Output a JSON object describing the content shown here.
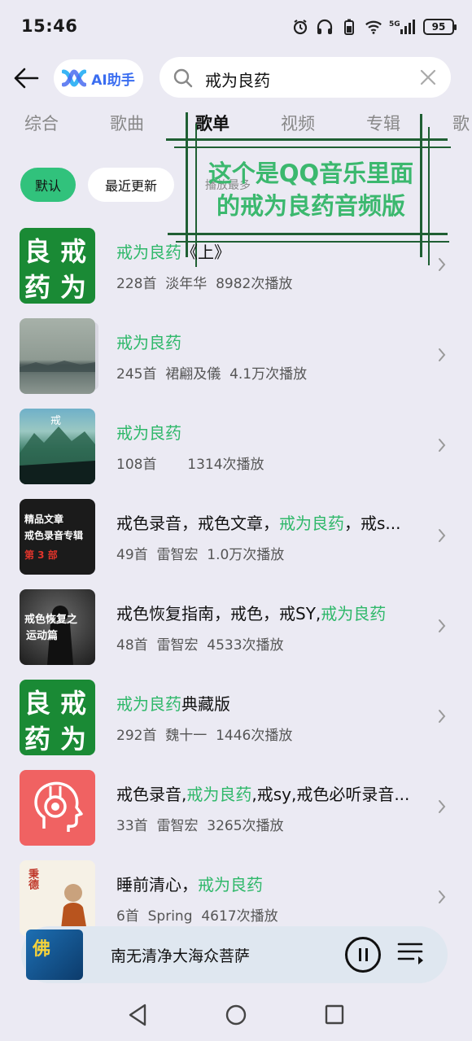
{
  "status": {
    "time": "15:46",
    "battery": "95",
    "network": "5G"
  },
  "header": {
    "ai_label": "AI助手",
    "search_value": "戒为良药"
  },
  "tabs": [
    "综合",
    "歌曲",
    "歌单",
    "视频",
    "专辑",
    "歌"
  ],
  "active_tab": "歌单",
  "filters": {
    "default": "默认",
    "recent": "最近更新",
    "most_played": "播放最多"
  },
  "overlay": {
    "line1": "这个是QQ音乐里面",
    "line2": "的戒为良药音频版"
  },
  "playlists": [
    {
      "title_hl": "戒为良药",
      "title_rest": "《上》",
      "count": "228首",
      "author": "淡年华",
      "plays": "8982次播放"
    },
    {
      "title_hl": "戒为良药",
      "title_rest": "",
      "count": "245首",
      "author": "裙翩及儀",
      "plays": "4.1万次播放"
    },
    {
      "title_hl": "戒为良药",
      "title_rest": "",
      "count": "108首",
      "author": "",
      "plays": "1314次播放"
    },
    {
      "title_pre": "戒色录音，戒色文章，",
      "title_hl": "戒为良药",
      "title_rest": "，戒s...",
      "count": "49首",
      "author": "雷智宏",
      "plays": "1.0万次播放"
    },
    {
      "title_pre": "戒色恢复指南，戒色，戒SY,",
      "title_hl": "戒为良药",
      "title_rest": "",
      "count": "48首",
      "author": "雷智宏",
      "plays": "4533次播放"
    },
    {
      "title_hl": "戒为良药",
      "title_rest": "典藏版",
      "count": "292首",
      "author": "魏十一",
      "plays": "1446次播放"
    },
    {
      "title_pre": "戒色录音,",
      "title_hl": "戒为良药",
      "title_rest": ",戒sy,戒色必听录音...",
      "count": "33首",
      "author": "雷智宏",
      "plays": "3265次播放"
    },
    {
      "title_pre": "睡前清心，",
      "title_hl": "戒为良药",
      "title_rest": "",
      "count": "6首",
      "author": "Spring",
      "plays": "4617次播放"
    }
  ],
  "covers": {
    "green_chars": [
      "良",
      "戒",
      "药",
      "为"
    ],
    "c3_text": "戒",
    "c4_line1": "精品文章",
    "c4_line2": "戒色录音专辑",
    "c4_line3": "第 3 部",
    "c5_line1": "戒色恢复之",
    "c5_line2": "运动篇",
    "c8_text": "秉德"
  },
  "player": {
    "title": "南无清净大海众菩萨",
    "cover_char": "佛"
  },
  "colors": {
    "accent": "#31c27c",
    "highlight": "#2fb86a",
    "background": "#ebeaf3"
  }
}
